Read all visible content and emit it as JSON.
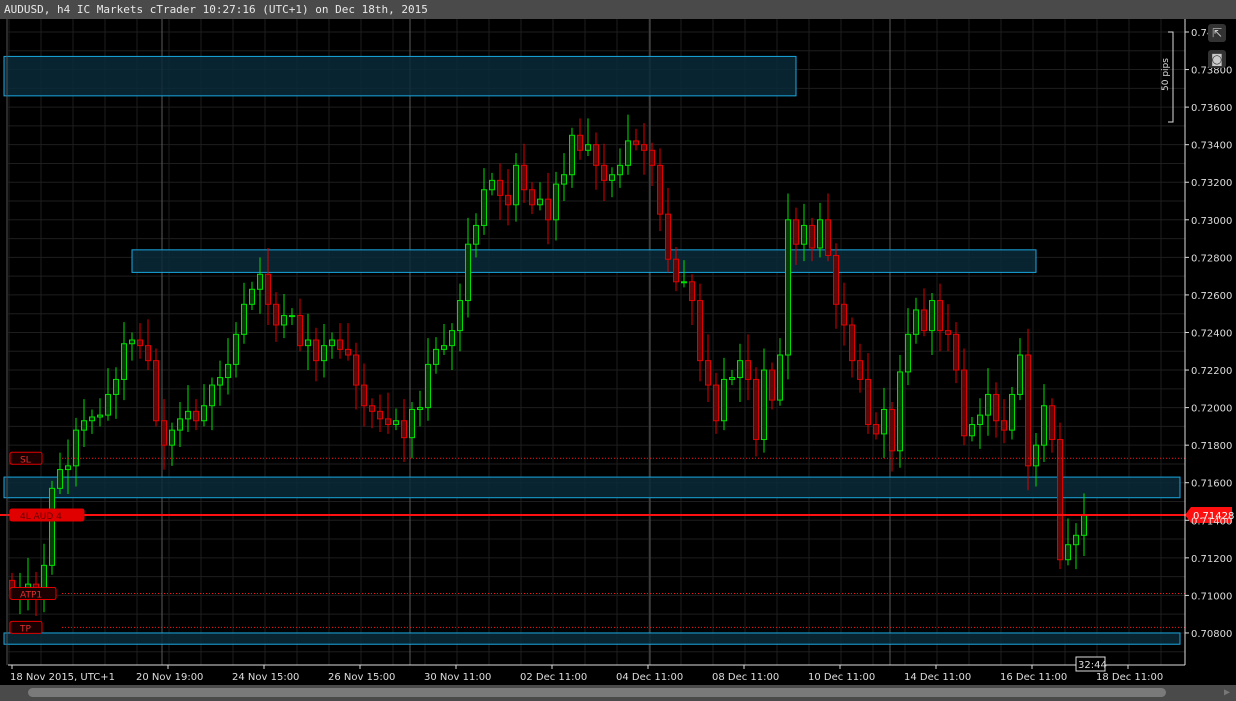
{
  "title": "AUDUSD, h4 IC Markets cTrader 10:27:16 (UTC+1) on Dec 18th, 2015",
  "toolbar": {
    "popout_icon": "external-link-icon",
    "screenshot_icon": "camera-icon"
  },
  "ruler_label": "50 pips",
  "countdown": "32:44",
  "colors": {
    "bull": "#00e000",
    "bear": "#e00000",
    "zone_fill": "#0a2a3a",
    "zone_border": "#1aa8e0",
    "line": "#ff1010"
  },
  "chart_data": {
    "type": "candlestick",
    "symbol": "AUDUSD",
    "timeframe": "h4",
    "ylim": [
      0.7066,
      0.7416
    ],
    "y_ticks": [
      {
        "value": 0.74,
        "label": "0.74"
      },
      {
        "value": 0.738,
        "label": "0.73800"
      },
      {
        "value": 0.736,
        "label": "0.73600"
      },
      {
        "value": 0.734,
        "label": "0.73400"
      },
      {
        "value": 0.732,
        "label": "0.73200"
      },
      {
        "value": 0.73,
        "label": "0.73000"
      },
      {
        "value": 0.728,
        "label": "0.72800"
      },
      {
        "value": 0.726,
        "label": "0.72600"
      },
      {
        "value": 0.724,
        "label": "0.72400"
      },
      {
        "value": 0.722,
        "label": "0.72200"
      },
      {
        "value": 0.72,
        "label": "0.72000"
      },
      {
        "value": 0.718,
        "label": "0.71800"
      },
      {
        "value": 0.716,
        "label": "0.71600"
      },
      {
        "value": 0.714,
        "label": "0.71400"
      },
      {
        "value": 0.712,
        "label": "0.71200"
      },
      {
        "value": 0.71,
        "label": "0.71000"
      },
      {
        "value": 0.708,
        "label": "0.70800"
      }
    ],
    "x_ticks": [
      {
        "index": 0,
        "label": "18 Nov 2015, UTC+1"
      },
      {
        "index": 19.5,
        "label": "20 Nov 19:00"
      },
      {
        "index": 31.5,
        "label": "24 Nov 15:00"
      },
      {
        "index": 43.5,
        "label": "26 Nov 15:00"
      },
      {
        "index": 55.5,
        "label": "30 Nov 11:00"
      },
      {
        "index": 67.5,
        "label": "02 Dec 11:00"
      },
      {
        "index": 79.5,
        "label": "04 Dec 11:00"
      },
      {
        "index": 91.5,
        "label": "08 Dec 11:00"
      },
      {
        "index": 103.5,
        "label": "10 Dec 11:00"
      },
      {
        "index": 115.5,
        "label": "14 Dec 11:00"
      },
      {
        "index": 127.5,
        "label": "16 Dec 11:00"
      },
      {
        "index": 139.5,
        "label": "18 Dec 11:00"
      }
    ],
    "week_separators": [
      18.75,
      49.75,
      79.75,
      109.75
    ],
    "first_open": 0.7108,
    "closes": [
      0.7103,
      0.7103,
      0.7106,
      0.7098,
      0.7116,
      0.7157,
      0.7167,
      0.7169,
      0.7188,
      0.7193,
      0.7195,
      0.7196,
      0.7207,
      0.7215,
      0.7234,
      0.7236,
      0.7233,
      0.7225,
      0.7193,
      0.718,
      0.7188,
      0.7194,
      0.7198,
      0.7193,
      0.7201,
      0.7212,
      0.7216,
      0.7223,
      0.7239,
      0.7255,
      0.7263,
      0.7271,
      0.7255,
      0.7244,
      0.7249,
      0.7249,
      0.7233,
      0.7236,
      0.7225,
      0.7233,
      0.7236,
      0.7231,
      0.7228,
      0.7212,
      0.7201,
      0.7198,
      0.7194,
      0.7191,
      0.7193,
      0.7184,
      0.7199,
      0.72,
      0.7223,
      0.7231,
      0.7233,
      0.7241,
      0.7257,
      0.7287,
      0.7297,
      0.7316,
      0.7321,
      0.7313,
      0.7308,
      0.7329,
      0.7316,
      0.7308,
      0.7311,
      0.73,
      0.7319,
      0.7324,
      0.7345,
      0.7337,
      0.734,
      0.7329,
      0.7321,
      0.7324,
      0.7329,
      0.7342,
      0.734,
      0.7337,
      0.7329,
      0.7303,
      0.7279,
      0.7267,
      0.7267,
      0.7257,
      0.7225,
      0.7212,
      0.7193,
      0.7215,
      0.7216,
      0.7225,
      0.7215,
      0.7183,
      0.722,
      0.7204,
      0.7228,
      0.73,
      0.7287,
      0.7297,
      0.7285,
      0.73,
      0.7281,
      0.7255,
      0.7244,
      0.7225,
      0.7215,
      0.7191,
      0.7186,
      0.7199,
      0.7177,
      0.7219,
      0.7239,
      0.7252,
      0.7241,
      0.7257,
      0.7241,
      0.7239,
      0.722,
      0.7185,
      0.7191,
      0.7196,
      0.7207,
      0.7193,
      0.7188,
      0.7207,
      0.7228,
      0.7169,
      0.718,
      0.7201,
      0.7183,
      0.7119,
      0.7127,
      0.7132,
      0.71428
    ],
    "zones": [
      {
        "from_index": -1,
        "to_index": 98,
        "top": 0.7387,
        "bottom": 0.7366
      },
      {
        "from_index": 15,
        "to_index": 128,
        "top": 0.7284,
        "bottom": 0.7272
      },
      {
        "from_index": -1,
        "to_index": 146,
        "top": 0.7163,
        "bottom": 0.7152
      },
      {
        "from_index": -1,
        "to_index": 146,
        "top": 0.708,
        "bottom": 0.7074
      }
    ],
    "levels": [
      {
        "label": "SL",
        "price": 0.7173,
        "style": "dotted"
      },
      {
        "label": "4L AUD 4",
        "price": 0.71428,
        "style": "solid",
        "price_label": "0.71428"
      },
      {
        "label": "ATP1",
        "price": 0.7101,
        "style": "dotted"
      },
      {
        "label": "TP",
        "price": 0.7083,
        "style": "dotted"
      }
    ]
  }
}
